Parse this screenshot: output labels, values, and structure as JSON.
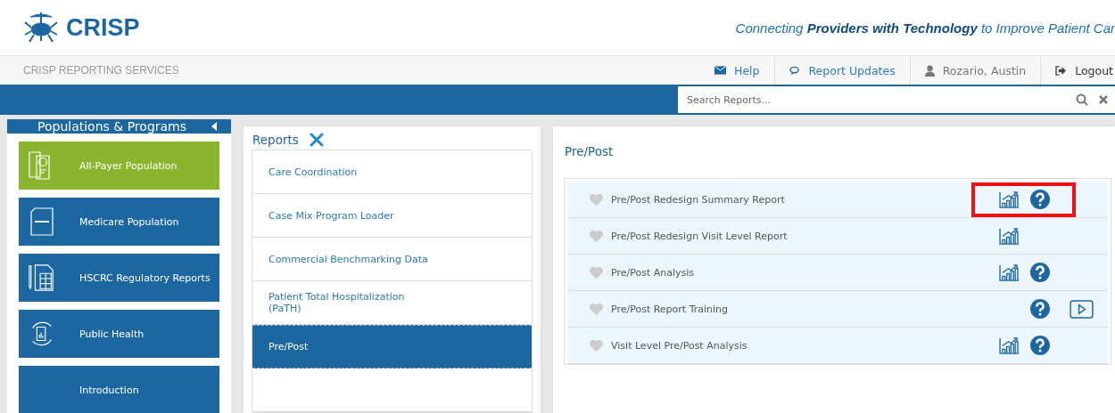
{
  "header": {
    "brand": "CRISP",
    "tagline": "Connecting **Providers with Technology** to Improve Patient Car"
  },
  "topbar": {
    "title": "CRISP REPORTING SERVICES",
    "links": [
      {
        "kind": "help",
        "label": "Help"
      },
      {
        "kind": "updates",
        "label": "Report Updates"
      },
      {
        "kind": "user",
        "label": "Rozario, Austin"
      },
      {
        "kind": "logout",
        "label": "Logout"
      }
    ]
  },
  "search": {
    "placeholder": "Search Reports..."
  },
  "sidebar": {
    "title": "Populations & Programs",
    "items": [
      {
        "kind": "payer",
        "label": "All-Payer Population",
        "selected": true
      },
      {
        "kind": "medicare",
        "label": "Medicare Population",
        "selected": false
      },
      {
        "kind": "calculator",
        "label": "HSCRC Regulatory Reports",
        "selected": false
      },
      {
        "kind": "cycle",
        "label": "Public Health",
        "selected": false
      },
      {
        "kind": "none",
        "label": "Introduction",
        "selected": false
      }
    ]
  },
  "reports": {
    "title": "Reports",
    "items": [
      {
        "label": "Care Coordination",
        "selected": false
      },
      {
        "label": "Case Mix Program Loader",
        "selected": false
      },
      {
        "label": "Commercial Benchmarking Data",
        "selected": false
      },
      {
        "label": "Patient Total Hospitalization\n(PaTH)",
        "selected": false
      },
      {
        "label": "Pre/Post",
        "selected": true
      }
    ]
  },
  "detail": {
    "title": "Pre/Post",
    "rows": [
      {
        "name": "Pre/Post Redesign Summary Report",
        "favorite": false,
        "chart": true,
        "help": true,
        "video": false,
        "highlighted": true
      },
      {
        "name": "Pre/Post Redesign Visit Level Report",
        "favorite": false,
        "chart": true,
        "help": false,
        "video": false,
        "highlighted": false
      },
      {
        "name": "Pre/Post Analysis",
        "favorite": false,
        "chart": true,
        "help": true,
        "video": false,
        "highlighted": false
      },
      {
        "name": "Pre/Post Report Training",
        "favorite": false,
        "chart": false,
        "help": true,
        "video": true,
        "highlighted": false
      },
      {
        "name": "Visit Level Pre/Post Analysis",
        "favorite": false,
        "chart": true,
        "help": true,
        "video": false,
        "highlighted": false
      }
    ]
  }
}
